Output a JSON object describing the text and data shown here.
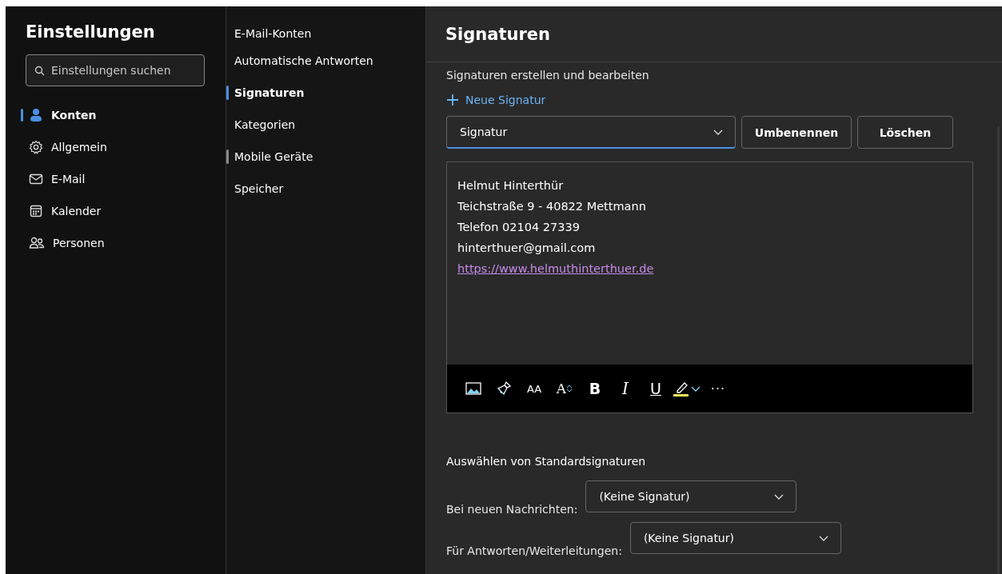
{
  "settings": {
    "title": "Einstellungen",
    "search": {
      "placeholder": "Einstellungen suchen"
    },
    "categories": [
      {
        "label": "Konten",
        "selected": true
      },
      {
        "label": "Allgemein",
        "selected": false
      },
      {
        "label": "E-Mail",
        "selected": false
      },
      {
        "label": "Kalender",
        "selected": false
      },
      {
        "label": "Personen",
        "selected": false
      }
    ]
  },
  "subnav": [
    {
      "label": "E-Mail-Konten",
      "selected": false,
      "hovered": false
    },
    {
      "label": "Automatische Antworten",
      "selected": false,
      "hovered": false
    },
    {
      "label": "Signaturen",
      "selected": true,
      "hovered": false
    },
    {
      "label": "Kategorien",
      "selected": false,
      "hovered": false
    },
    {
      "label": "Mobile Geräte",
      "selected": false,
      "hovered": true
    },
    {
      "label": "Speicher",
      "selected": false,
      "hovered": false
    }
  ],
  "main": {
    "title": "Signaturen",
    "section": "Signaturen erstellen und bearbeiten",
    "new_button": "Neue Signatur",
    "signature_select": {
      "value": "Signatur",
      "focused": true
    },
    "buttons": [
      "Umbenennen",
      "Löschen"
    ],
    "signature_lines": [
      {
        "kind": "text",
        "text": "Helmut Hinterthür"
      },
      {
        "kind": "text",
        "text": "Teichstraße 9 - 40822 Mettmann"
      },
      {
        "kind": "text",
        "text": "Telefon 02104 27339"
      },
      {
        "kind": "text",
        "text": "hinterthuer@gmail.com"
      },
      {
        "kind": "link",
        "text": "https://www.helmuthinterthuer.de"
      }
    ],
    "toolbar": {
      "font_size": "AA",
      "font_grow": "A",
      "bold": "B",
      "italic": "I",
      "underline": "U",
      "more": "···"
    },
    "defaults_title": "Auswählen von Standardsignaturen",
    "defaults": [
      {
        "label": "Bei neuen Nachrichten:",
        "value": "(Keine Signatur)"
      },
      {
        "label": "Für Antworten/Weiterleitungen:",
        "value": "(Keine Signatur)"
      }
    ]
  }
}
